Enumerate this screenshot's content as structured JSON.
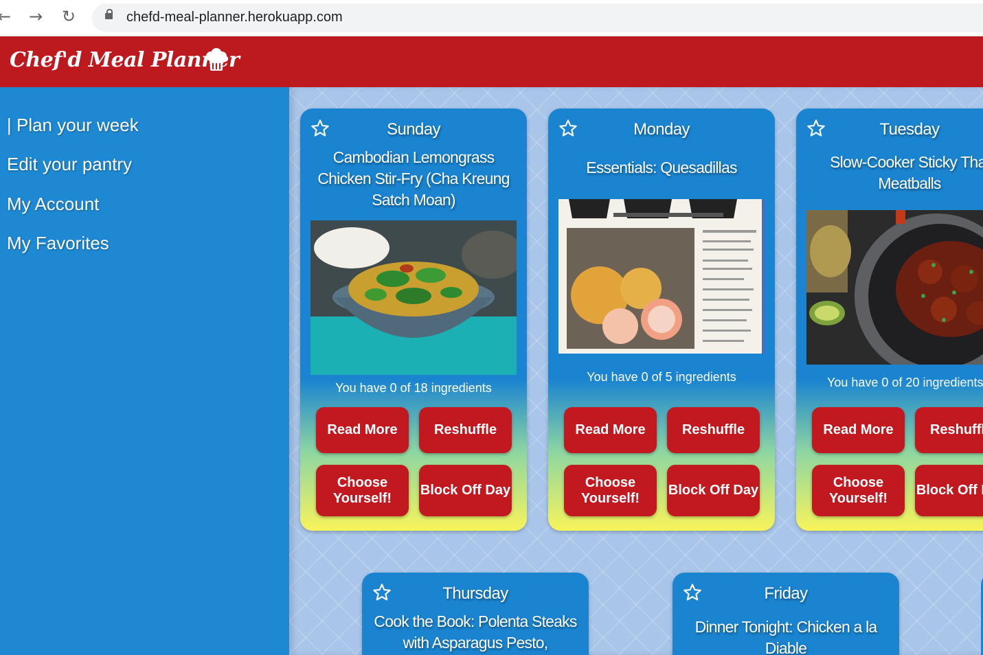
{
  "browser": {
    "url": "chefd-meal-planner.herokuapp.com",
    "back_glyph": "←",
    "forward_glyph": "→",
    "reload_glyph": "↻"
  },
  "header": {
    "logo_text": "Chef'd Meal Planner",
    "logo_icon": "chef-hat-icon",
    "color": "#bd1a1f"
  },
  "sidebar": {
    "items": [
      {
        "label": "| Plan your week"
      },
      {
        "label": "Edit your pantry"
      },
      {
        "label": "My Account"
      },
      {
        "label": "My Favorites"
      }
    ],
    "color": "#1e88d2"
  },
  "buttons": {
    "read_more": "Read More",
    "reshuffle": "Reshuffle",
    "choose": "Choose Yourself!",
    "block": "Block Off Day"
  },
  "cards": [
    {
      "day": "Sunday",
      "title": "Cambodian Lemongrass Chicken Stir-Fry (Cha Kreung Satch Moan)",
      "ingredients": "You have 0 of 18 ingredients"
    },
    {
      "day": "Monday",
      "title": "Essentials: Quesadillas",
      "ingredients": "You have 0 of 5 ingredients"
    },
    {
      "day": "Tuesday",
      "title": "Slow-Cooker Sticky Thai Meatballs",
      "ingredients": "You have 0 of 20 ingredients"
    },
    {
      "day": "Thursday",
      "title": "Cook the Book: Polenta Steaks with Asparagus Pesto,"
    },
    {
      "day": "Friday",
      "title": "Dinner Tonight: Chicken a la Diable"
    }
  ],
  "colors": {
    "button": "#c1191f",
    "card_top": "#1a84d0",
    "card_bottom": "#f8f45a",
    "background": "#a9c6ea"
  }
}
